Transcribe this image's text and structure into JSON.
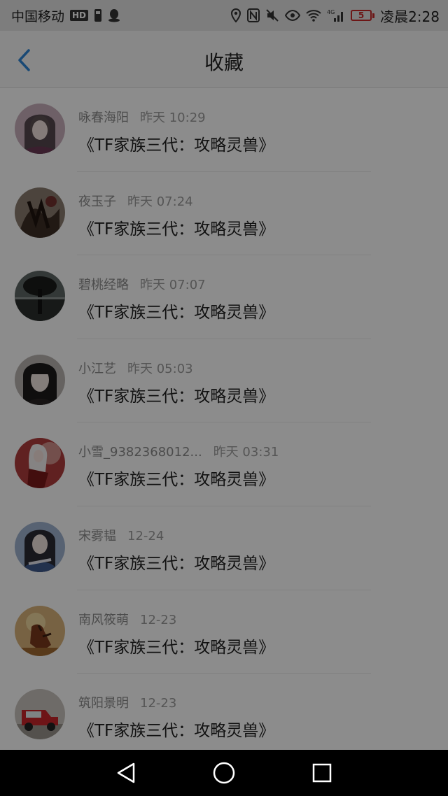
{
  "status_bar": {
    "carrier": "中国移动",
    "hd_badge": "HD",
    "battery_level": "5",
    "time": "凌晨2:28",
    "icons": [
      "sim-icon",
      "qq-icon",
      "location-icon",
      "nfc-icon",
      "mute-icon",
      "eye-icon",
      "wifi-icon",
      "signal-4g-icon",
      "battery-icon"
    ]
  },
  "header": {
    "title": "收藏",
    "back_icon": "chevron-left-icon"
  },
  "favorites": [
    {
      "name": "咏春海阳",
      "time": "昨天 10:29",
      "title": "《TF家族三代：攻略灵兽》",
      "avatar_color": "#c9b0bc"
    },
    {
      "name": "夜玉子",
      "time": "昨天 07:24",
      "title": "《TF家族三代：攻略灵兽》",
      "avatar_color": "#5a4a44"
    },
    {
      "name": "碧桃经略",
      "time": "昨天 07:07",
      "title": "《TF家族三代：攻略灵兽》",
      "avatar_color": "#3a3f3c"
    },
    {
      "name": "小江艺",
      "time": "昨天 05:03",
      "title": "《TF家族三代：攻略灵兽》",
      "avatar_color": "#6e6b6a"
    },
    {
      "name": "小雪_9382368012...",
      "time": "昨天 03:31",
      "title": "《TF家族三代：攻略灵兽》",
      "avatar_color": "#a83a3a"
    },
    {
      "name": "宋雾韫",
      "time": "12-24",
      "title": "《TF家族三代：攻略灵兽》",
      "avatar_color": "#7e93b5"
    },
    {
      "name": "南风筱萌",
      "time": "12-23",
      "title": "《TF家族三代：攻略灵兽》",
      "avatar_color": "#b8864a"
    },
    {
      "name": "筑阳景明",
      "time": "12-23",
      "title": "《TF家族三代：攻略灵兽》",
      "avatar_color": "#c23a3a"
    }
  ],
  "system_nav": {
    "back": "triangle-back-icon",
    "home": "circle-home-icon",
    "recents": "square-recents-icon"
  },
  "colors": {
    "accent": "#2f86d6",
    "overlay": "rgba(0,0,0,0.45)"
  }
}
